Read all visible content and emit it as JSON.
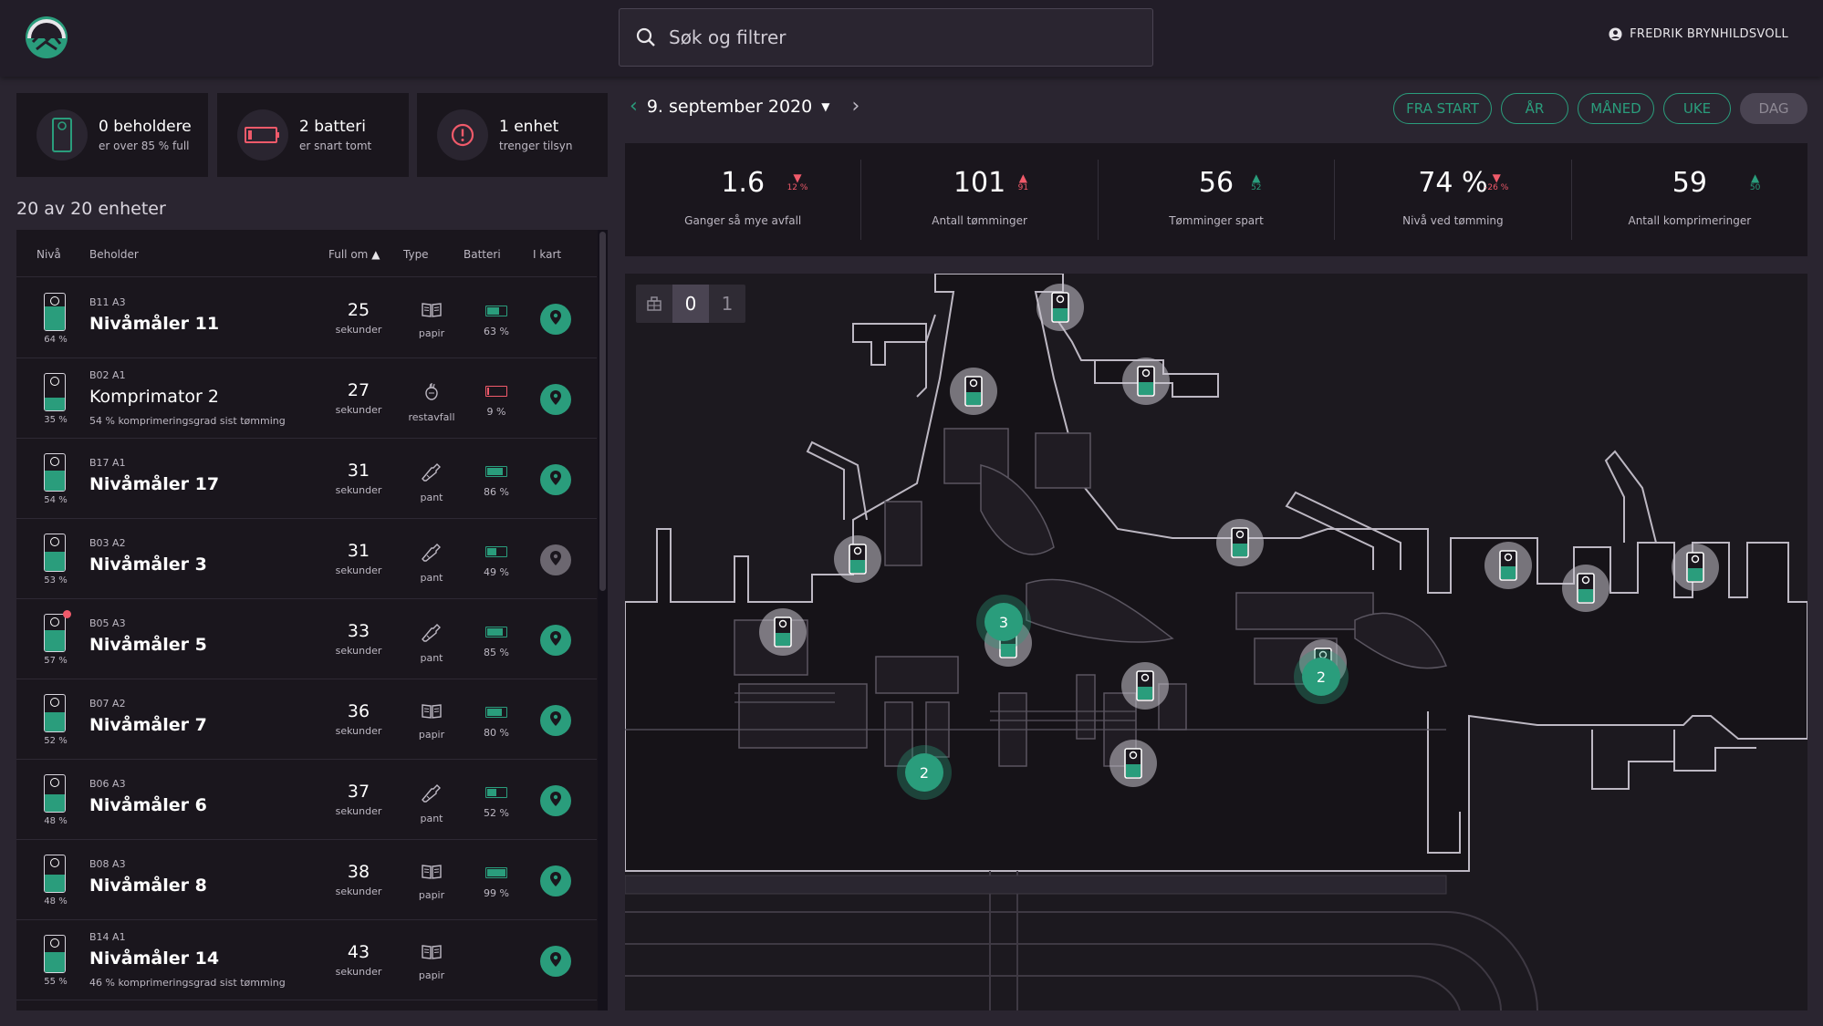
{
  "header": {
    "search_placeholder": "Søk og filtrer",
    "user_name": "FREDRIK BRYNHILDSVOLL"
  },
  "summary": [
    {
      "title": "0 beholdere",
      "subtitle": "er over 85 % full",
      "icon": "container-icon"
    },
    {
      "title": "2 batteri",
      "subtitle": "er snart tomt",
      "icon": "battery-low-icon"
    },
    {
      "title": "1 enhet",
      "subtitle": "trenger tilsyn",
      "icon": "alert-icon"
    }
  ],
  "list": {
    "count_title": "20 av 20 enheter",
    "headers": {
      "level": "Nivå",
      "container": "Beholder",
      "full_in": "Full om",
      "type": "Type",
      "battery": "Batteri",
      "in_map": "I kart"
    },
    "rows": [
      {
        "level": "64 %",
        "level_value": 64,
        "code": "B11 A3",
        "name": "Nivåmåler 11",
        "sub": "",
        "seconds": "25",
        "unit": "sekunder",
        "type": "papir",
        "type_icon": "paper-icon",
        "battery": "63 %",
        "battery_value": 63,
        "battery_low": false,
        "pin_active": true,
        "alert": false
      },
      {
        "level": "35 %",
        "level_value": 35,
        "code": "B02 A1",
        "name": "Komprimator 2",
        "sub": "54 % komprimeringsgrad sist tømming",
        "seconds": "27",
        "unit": "sekunder",
        "type": "restavfall",
        "type_icon": "residual-waste-icon",
        "battery": "9 %",
        "battery_value": 9,
        "battery_low": true,
        "pin_active": true,
        "alert": false
      },
      {
        "level": "54 %",
        "level_value": 54,
        "code": "B17 A1",
        "name": "Nivåmåler 17",
        "sub": "",
        "seconds": "31",
        "unit": "sekunder",
        "type": "pant",
        "type_icon": "bottle-icon",
        "battery": "86 %",
        "battery_value": 86,
        "battery_low": false,
        "pin_active": true,
        "alert": false
      },
      {
        "level": "53 %",
        "level_value": 53,
        "code": "B03 A2",
        "name": "Nivåmåler 3",
        "sub": "",
        "seconds": "31",
        "unit": "sekunder",
        "type": "pant",
        "type_icon": "bottle-icon",
        "battery": "49 %",
        "battery_value": 49,
        "battery_low": false,
        "pin_active": false,
        "alert": false
      },
      {
        "level": "57 %",
        "level_value": 57,
        "code": "B05 A3",
        "name": "Nivåmåler 5",
        "sub": "",
        "seconds": "33",
        "unit": "sekunder",
        "type": "pant",
        "type_icon": "bottle-icon",
        "battery": "85 %",
        "battery_value": 85,
        "battery_low": false,
        "pin_active": true,
        "alert": true
      },
      {
        "level": "52 %",
        "level_value": 52,
        "code": "B07 A2",
        "name": "Nivåmåler 7",
        "sub": "",
        "seconds": "36",
        "unit": "sekunder",
        "type": "papir",
        "type_icon": "paper-icon",
        "battery": "80 %",
        "battery_value": 80,
        "battery_low": false,
        "pin_active": true,
        "alert": false
      },
      {
        "level": "48 %",
        "level_value": 48,
        "code": "B06 A3",
        "name": "Nivåmåler 6",
        "sub": "",
        "seconds": "37",
        "unit": "sekunder",
        "type": "pant",
        "type_icon": "bottle-icon",
        "battery": "52 %",
        "battery_value": 52,
        "battery_low": false,
        "pin_active": true,
        "alert": false
      },
      {
        "level": "48 %",
        "level_value": 48,
        "code": "B08 A3",
        "name": "Nivåmåler 8",
        "sub": "",
        "seconds": "38",
        "unit": "sekunder",
        "type": "papir",
        "type_icon": "paper-icon",
        "battery": "99 %",
        "battery_value": 99,
        "battery_low": false,
        "pin_active": true,
        "alert": false
      },
      {
        "level": "55 %",
        "level_value": 55,
        "code": "B14 A1",
        "name": "Nivåmåler 14",
        "sub": "46 % komprimeringsgrad sist tømming",
        "seconds": "43",
        "unit": "sekunder",
        "type": "papir",
        "type_icon": "paper-icon",
        "battery": "",
        "battery_value": null,
        "battery_low": false,
        "pin_active": true,
        "alert": false
      }
    ]
  },
  "date_nav": {
    "date": "9. september 2020"
  },
  "ranges": [
    {
      "label": "FRA START",
      "active": false
    },
    {
      "label": "ÅR",
      "active": false
    },
    {
      "label": "MÅNED",
      "active": false
    },
    {
      "label": "UKE",
      "active": false
    },
    {
      "label": "DAG",
      "active": true
    }
  ],
  "stats": [
    {
      "value": "1.6",
      "trend": "12 %",
      "direction": "down",
      "label": "Ganger så mye avfall"
    },
    {
      "value": "101",
      "trend": "91",
      "direction": "up-red",
      "label": "Antall tømminger"
    },
    {
      "value": "56",
      "trend": "52",
      "direction": "up",
      "label": "Tømminger spart"
    },
    {
      "value": "74 %",
      "trend": "-26 %",
      "direction": "down",
      "label": "Nivå ved tømming"
    },
    {
      "value": "59",
      "trend": "50",
      "direction": "up",
      "label": "Antall komprimeringer"
    }
  ],
  "map": {
    "floors": [
      "0",
      "1"
    ],
    "active_floor": "0",
    "clusters": [
      "3",
      "2",
      "2"
    ]
  },
  "colors": {
    "accent": "#2a9d7c",
    "alert": "#f05a6a",
    "panel": "#1a161d",
    "background": "#2a2530"
  }
}
